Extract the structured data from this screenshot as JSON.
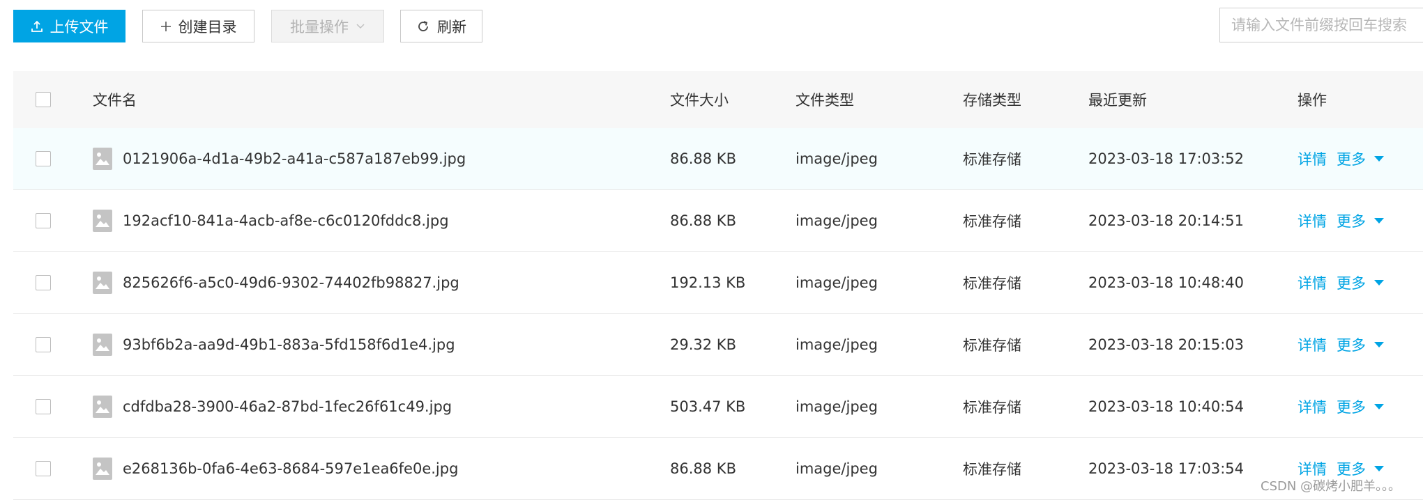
{
  "toolbar": {
    "upload_label": "上传文件",
    "mkdir_label": "创建目录",
    "batch_label": "批量操作",
    "refresh_label": "刷新"
  },
  "search": {
    "placeholder": "请输入文件前缀按回车搜索"
  },
  "table": {
    "headers": {
      "name": "文件名",
      "size": "文件大小",
      "type": "文件类型",
      "storage": "存储类型",
      "updated": "最近更新",
      "actions": "操作"
    },
    "rows": [
      {
        "name": "0121906a-4d1a-49b2-a41a-c587a187eb99.jpg",
        "size": "86.88 KB",
        "type": "image/jpeg",
        "storage": "标准存储",
        "updated": "2023-03-18 17:03:52",
        "detail": "详情",
        "more": "更多"
      },
      {
        "name": "192acf10-841a-4acb-af8e-c6c0120fddc8.jpg",
        "size": "86.88 KB",
        "type": "image/jpeg",
        "storage": "标准存储",
        "updated": "2023-03-18 20:14:51",
        "detail": "详情",
        "more": "更多"
      },
      {
        "name": "825626f6-a5c0-49d6-9302-74402fb98827.jpg",
        "size": "192.13 KB",
        "type": "image/jpeg",
        "storage": "标准存储",
        "updated": "2023-03-18 10:48:40",
        "detail": "详情",
        "more": "更多"
      },
      {
        "name": "93bf6b2a-aa9d-49b1-883a-5fd158f6d1e4.jpg",
        "size": "29.32 KB",
        "type": "image/jpeg",
        "storage": "标准存储",
        "updated": "2023-03-18 20:15:03",
        "detail": "详情",
        "more": "更多"
      },
      {
        "name": "cdfdba28-3900-46a2-87bd-1fec26f61c49.jpg",
        "size": "503.47 KB",
        "type": "image/jpeg",
        "storage": "标准存储",
        "updated": "2023-03-18 10:40:54",
        "detail": "详情",
        "more": "更多"
      },
      {
        "name": "e268136b-0fa6-4e63-8684-597e1ea6fe0e.jpg",
        "size": "86.88 KB",
        "type": "image/jpeg",
        "storage": "标准存储",
        "updated": "2023-03-18 17:03:54",
        "detail": "详情",
        "more": "更多"
      }
    ]
  },
  "watermark": "CSDN @碳烤小肥羊。。。",
  "colors": {
    "accent": "#00a4e4",
    "header_bg": "#f7f7f7",
    "highlight_row": "#f5fdfe"
  },
  "icons": {
    "upload": "upload-icon",
    "mkdir": "plus-icon",
    "batch": "chevron-down-icon",
    "refresh": "refresh-icon",
    "file": "image-file-icon",
    "more": "caret-down-icon"
  }
}
